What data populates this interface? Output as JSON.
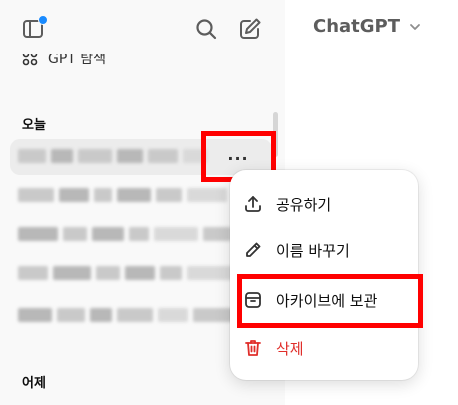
{
  "header": {
    "title": "ChatGPT"
  },
  "sidebar": {
    "partial_item_text": "GPT 탐색",
    "sections": {
      "today": "오늘",
      "yesterday": "어제"
    },
    "more_button_label": "···"
  },
  "context_menu": {
    "share": "공유하기",
    "rename": "이름 바꾸기",
    "archive": "아카이브에 보관",
    "delete": "삭제"
  },
  "colors": {
    "delete": "#e02e2a",
    "notify_dot": "#1a8bff",
    "highlight": "#ff0000"
  },
  "icons": [
    "sidebar-toggle-icon",
    "search-icon",
    "new-chat-icon",
    "gpts-icon",
    "more-icon",
    "share-icon",
    "pencil-icon",
    "archive-icon",
    "trash-icon",
    "chevron-down-icon"
  ]
}
